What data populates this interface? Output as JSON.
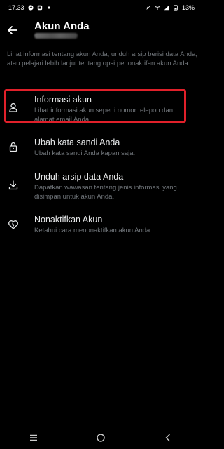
{
  "status": {
    "time": "17.33",
    "battery": "13%"
  },
  "header": {
    "title": "Akun Anda"
  },
  "intro": "Lihat informasi tentang akun Anda, unduh arsip berisi data Anda, atau pelajari lebih lanjut tentang opsi penonaktifan akun Anda.",
  "items": [
    {
      "label": "Informasi akun",
      "desc": "Lihat informasi akun seperti nomor telepon dan alamat email Anda.",
      "icon": "person-icon"
    },
    {
      "label": "Ubah kata sandi Anda",
      "desc": "Ubah kata sandi Anda kapan saja.",
      "icon": "lock-icon"
    },
    {
      "label": "Unduh arsip data Anda",
      "desc": "Dapatkan wawasan tentang jenis informasi yang disimpan untuk akun Anda.",
      "icon": "download-icon"
    },
    {
      "label": "Nonaktifkan Akun",
      "desc": "Ketahui cara menonaktifkan akun Anda.",
      "icon": "broken-heart-icon"
    }
  ],
  "highlight_color": "#e0202a"
}
